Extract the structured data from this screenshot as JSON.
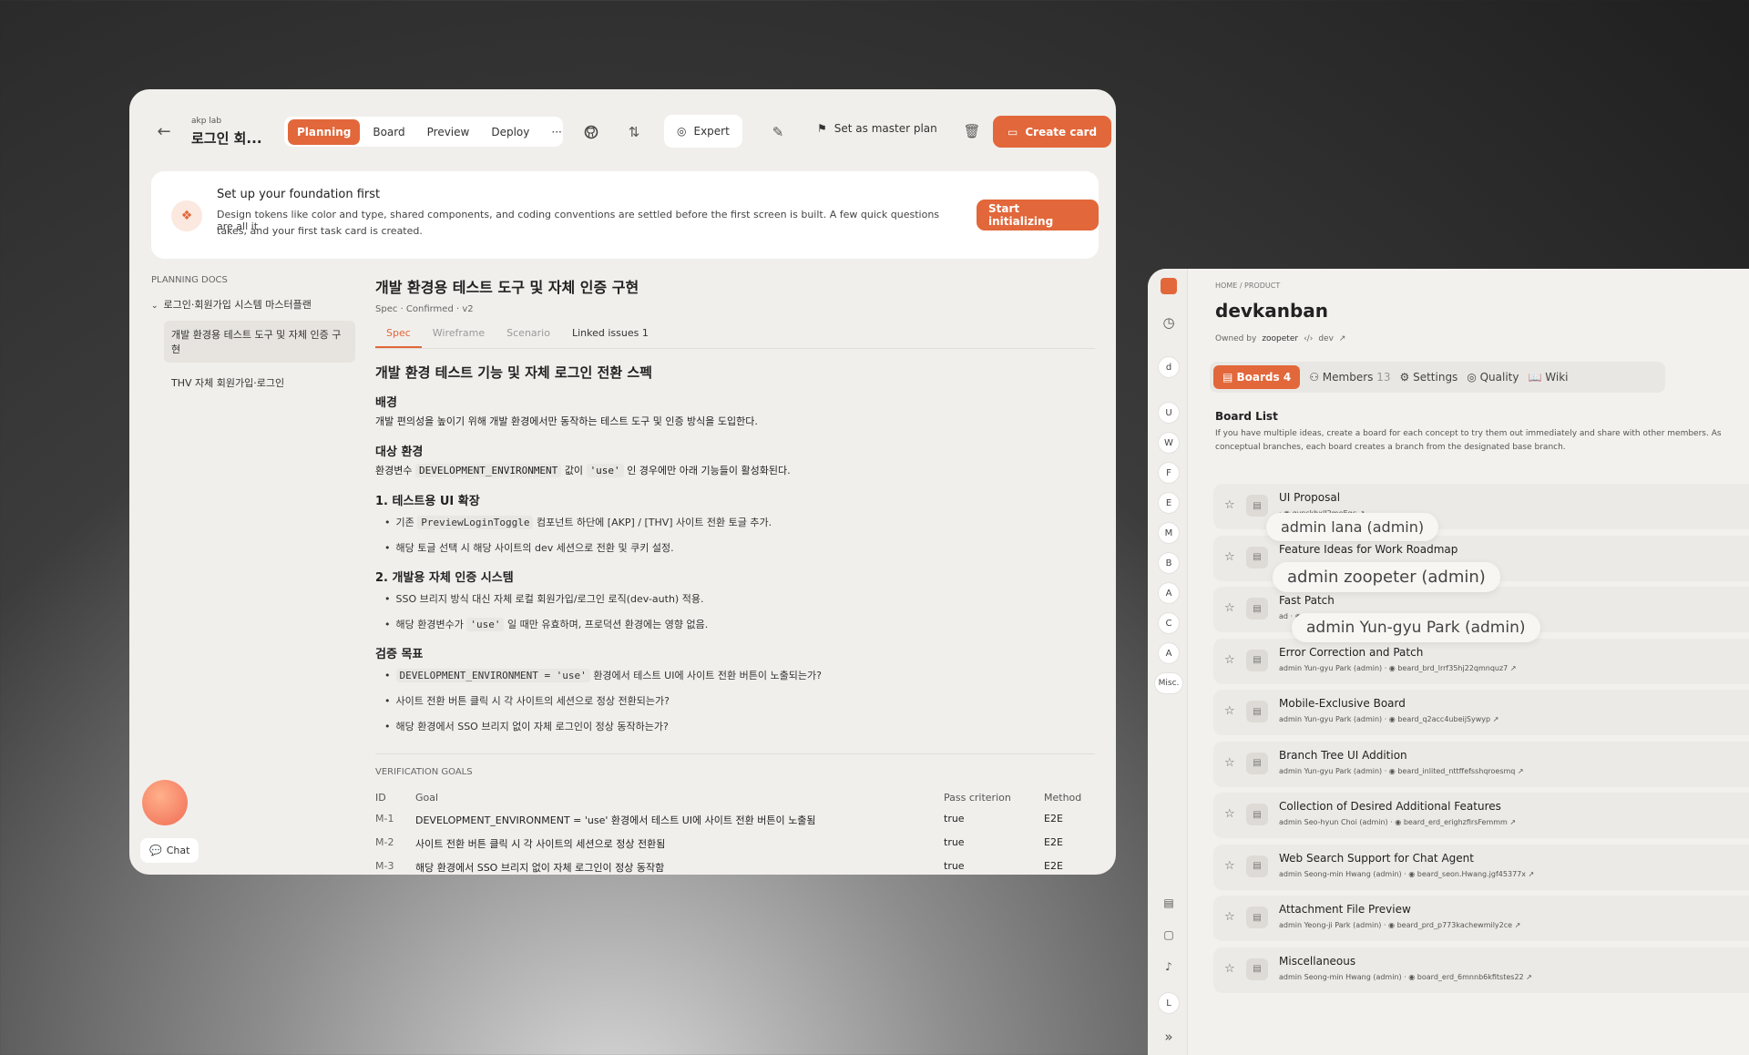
{
  "top": {
    "workspace": "akp lab",
    "title": "로그인 회...",
    "tabs": [
      "Planning",
      "Board",
      "Preview",
      "Deploy",
      "···"
    ],
    "expert": "Expert",
    "master": "Set as master plan",
    "create": "Create card"
  },
  "banner": {
    "title": "Set up your foundation first",
    "text1": "Design tokens like color and type, shared components, and coding conventions are settled before the first screen is built. A few quick questions are all it",
    "text2": "takes, and your first task card is created.",
    "cta": "Start initializing"
  },
  "docs": {
    "header": "PLANNING DOCS",
    "parent": "로그인·회원가입 시스템 마스터플랜",
    "items": [
      "개발 환경용 테스트 도구 및 자체 인증 구현",
      "THV 자체 회원가입·로그인"
    ]
  },
  "spec": {
    "title": "개발 환경용 테스트 도구 및 자체 인증 구현",
    "meta": "Spec · Confirmed · v2",
    "tabs": [
      "Spec",
      "Wireframe",
      "Scenario",
      "Linked issues"
    ],
    "linked": "1",
    "h1": "개발 환경 테스트 기능 및 자체 로그인 전환 스펙",
    "s1": "배경",
    "p1": "개발 편의성을 높이기 위해 개발 환경에서만 동작하는 테스트 도구 및 인증 방식을 도입한다.",
    "s2": "대상 환경",
    "p2a": "환경변수",
    "p2b": "DEVELOPMENT_ENVIRONMENT",
    "p2c": "값이",
    "p2d": "'use'",
    "p2e": "인 경우에만 아래 기능들이 활성화된다.",
    "s3": "1. 테스트용 UI 확장",
    "l3a1": "기존",
    "l3a2": "PreviewLoginToggle",
    "l3a3": "컴포넌트 하단에 [AKP] / [THV] 사이트 전환 토글 추가.",
    "l3b": "해당 토글 선택 시 해당 사이트의 dev 세션으로 전환 및 쿠키 설정.",
    "s4": "2. 개발용 자체 인증 시스템",
    "l4a": "SSO 브리지 방식 대신 자체 로컬 회원가입/로그인 로직(dev-auth) 적용.",
    "l4b1": "해당 환경변수가",
    "l4b2": "'use'",
    "l4b3": "일 때만 유효하며, 프로덕션 환경에는 영향 없음.",
    "s5": "검증 목표",
    "l5a1": "DEVELOPMENT_ENVIRONMENT = 'use'",
    "l5a2": "환경에서 테스트 UI에 사이트 전환 버튼이 노출되는가?",
    "l5b": "사이트 전환 버튼 클릭 시 각 사이트의 세션으로 정상 전환되는가?",
    "l5c": "해당 환경에서 SSO 브리지 없이 자체 로그인이 정상 동작하는가?",
    "vg": "VERIFICATION GOALS",
    "cols": [
      "ID",
      "Goal",
      "Pass criterion",
      "Method"
    ],
    "rows": [
      [
        "M-1",
        "DEVELOPMENT_ENVIRONMENT = 'use' 환경에서 테스트 UI에 사이트 전환 버튼이 노출됨",
        "true",
        "E2E"
      ],
      [
        "M-2",
        "사이트 전환 버튼 클릭 시 각 사이트의 세션으로 정상 전환됨",
        "true",
        "E2E"
      ],
      [
        "M-3",
        "해당 환경에서 SSO 브리지 없이 자체 로그인이 정상 동작함",
        "true",
        "E2E"
      ]
    ]
  },
  "chat": "Chat",
  "kanban": {
    "crumb": "HOME  /  PRODUCT",
    "title": "devkanban",
    "owned": "Owned by",
    "owner": "zoopeter",
    "branch": "dev",
    "tabs": [
      [
        "Boards",
        "4"
      ],
      [
        "Members",
        "13"
      ],
      [
        "Settings",
        ""
      ],
      [
        "Quality",
        ""
      ],
      [
        "Wiki",
        ""
      ]
    ],
    "listTitle": "Board List",
    "desc1": "If you have multiple ideas, create a board for each concept to try them out immediately and share with other members. As",
    "desc2": "conceptual branches, each board creates a branch from the designated base branch.",
    "side": [
      "d",
      "U",
      "W",
      "F",
      "E",
      "M",
      "B",
      "A",
      "C",
      "A",
      "Misc."
    ],
    "boards": [
      [
        "UI Proposal",
        "",
        "gvnskhxlJ2meEqc"
      ],
      [
        "Feature Ideas for Work Roadmap",
        "",
        "eciq"
      ],
      [
        "Fast Patch",
        "ad",
        "prgwotmmzfbvaj6"
      ],
      [
        "Error Correction and Patch",
        "admin Yun-gyu Park (admin)",
        "beard_brd_lrrf35hj22qmnquz7"
      ],
      [
        "Mobile-Exclusive Board",
        "admin Yun-gyu Park (admin)",
        "beard_q2acc4ubeijSywyp"
      ],
      [
        "Branch Tree UI Addition",
        "admin Yun-gyu Park (admin)",
        "beard_inlited_nttffefsshqroesmq"
      ],
      [
        "Collection of Desired Additional Features",
        "admin Seo-hyun Choi (admin)",
        "beard_erd_erighzfirsFemmm"
      ],
      [
        "Web Search Support for Chat Agent",
        "admin Seong-min Hwang (admin)",
        "beard_seon.Hwang.jgf45377x"
      ],
      [
        "Attachment File Preview",
        "admin Yeong-ji Park (admin)",
        "beard_prd_p773kachewmily2ce"
      ],
      [
        "Miscellaneous",
        "admin Seong-min Hwang (admin)",
        "board_erd_6mnnb6kfitstes22"
      ]
    ],
    "tips": [
      "admin lana (admin)",
      "admin zoopeter (admin)",
      "admin Yun-gyu Park (admin)"
    ]
  }
}
